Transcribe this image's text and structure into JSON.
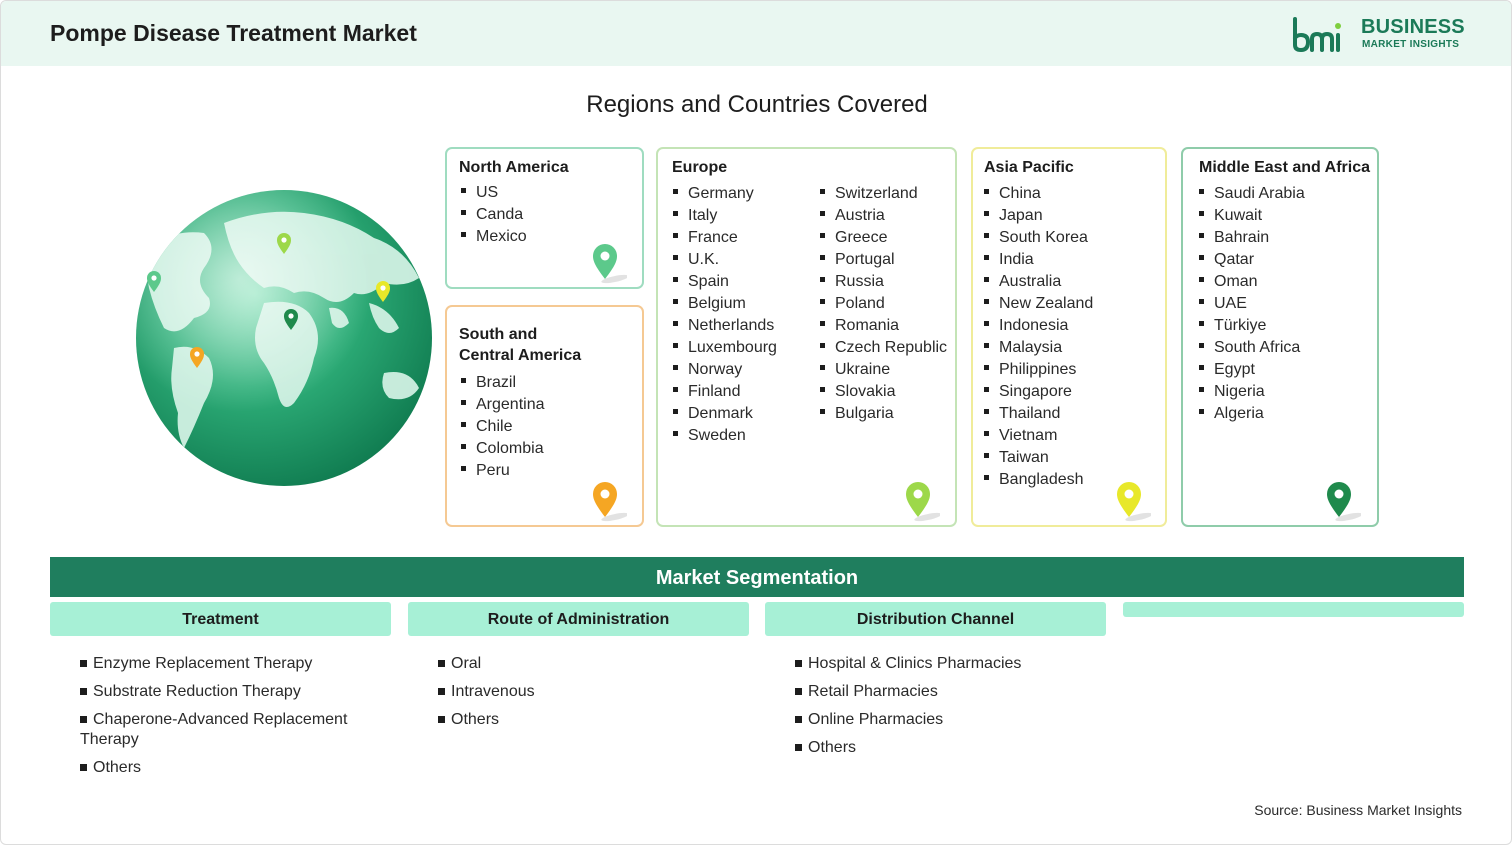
{
  "header": {
    "title": "Pompe Disease Treatment Market",
    "logo_name": "bmi-logo",
    "brand_line1": "BUSINESS",
    "brand_line2": "MARKET INSIGHTS"
  },
  "regions_title": "Regions and Countries Covered",
  "regions": {
    "north_america": {
      "name": "North America",
      "countries": [
        "US",
        "Canda",
        "Mexico"
      ],
      "pin_color": "#5cc98b"
    },
    "south_central_america": {
      "name_line1": "South and",
      "name_line2": "Central America",
      "countries": [
        "Brazil",
        "Argentina",
        "Chile",
        "Colombia",
        "Peru"
      ],
      "pin_color": "#f5a623"
    },
    "europe": {
      "name": "Europe",
      "countries_col1": [
        "Germany",
        "Italy",
        "France",
        "U.K.",
        "Spain",
        "Belgium",
        "Netherlands",
        "Luxembourg",
        "Norway",
        "Finland",
        "Denmark",
        "Sweden"
      ],
      "countries_col2": [
        "Switzerland",
        "Austria",
        "Greece",
        "Portugal",
        "Russia",
        "Poland",
        "Romania",
        "Czech Republic",
        "Ukraine",
        "Slovakia",
        "Bulgaria"
      ],
      "pin_color": "#9dd84a"
    },
    "asia_pacific": {
      "name": "Asia Pacific",
      "countries": [
        "China",
        "Japan",
        "South Korea",
        "India",
        "Australia",
        "New Zealand",
        "Indonesia",
        "Malaysia",
        "Philippines",
        "Singapore",
        "Thailand",
        "Vietnam",
        "Taiwan",
        "Bangladesh"
      ],
      "pin_color": "#e8e82a"
    },
    "middle_east_africa": {
      "name": "Middle East and Africa",
      "countries": [
        "Saudi Arabia",
        "Kuwait",
        "Bahrain",
        "Qatar",
        "Oman",
        "UAE",
        "Türkiye",
        "South Africa",
        "Egypt",
        "Nigeria",
        "Algeria"
      ],
      "pin_color": "#1f8a4c"
    }
  },
  "segmentation": {
    "title": "Market Segmentation",
    "columns": [
      {
        "header": "Treatment",
        "items": [
          "Enzyme Replacement Therapy",
          "Substrate Reduction Therapy",
          "Chaperone-Advanced Replacement Therapy",
          "Others"
        ]
      },
      {
        "header": "Route of Administration",
        "items": [
          "Oral",
          "Intravenous",
          "Others"
        ]
      },
      {
        "header": "Distribution Channel",
        "items": [
          "Hospital & Clinics Pharmacies",
          "Retail Pharmacies",
          "Online Pharmacies",
          "Others"
        ]
      },
      {
        "header": "",
        "items": []
      }
    ]
  },
  "source": "Source: Business Market Insights",
  "colors": {
    "header_bg": "#e9f7f1",
    "accent_dark_green": "#1f7e5e",
    "segment_header_bg": "#a7f0d6"
  }
}
